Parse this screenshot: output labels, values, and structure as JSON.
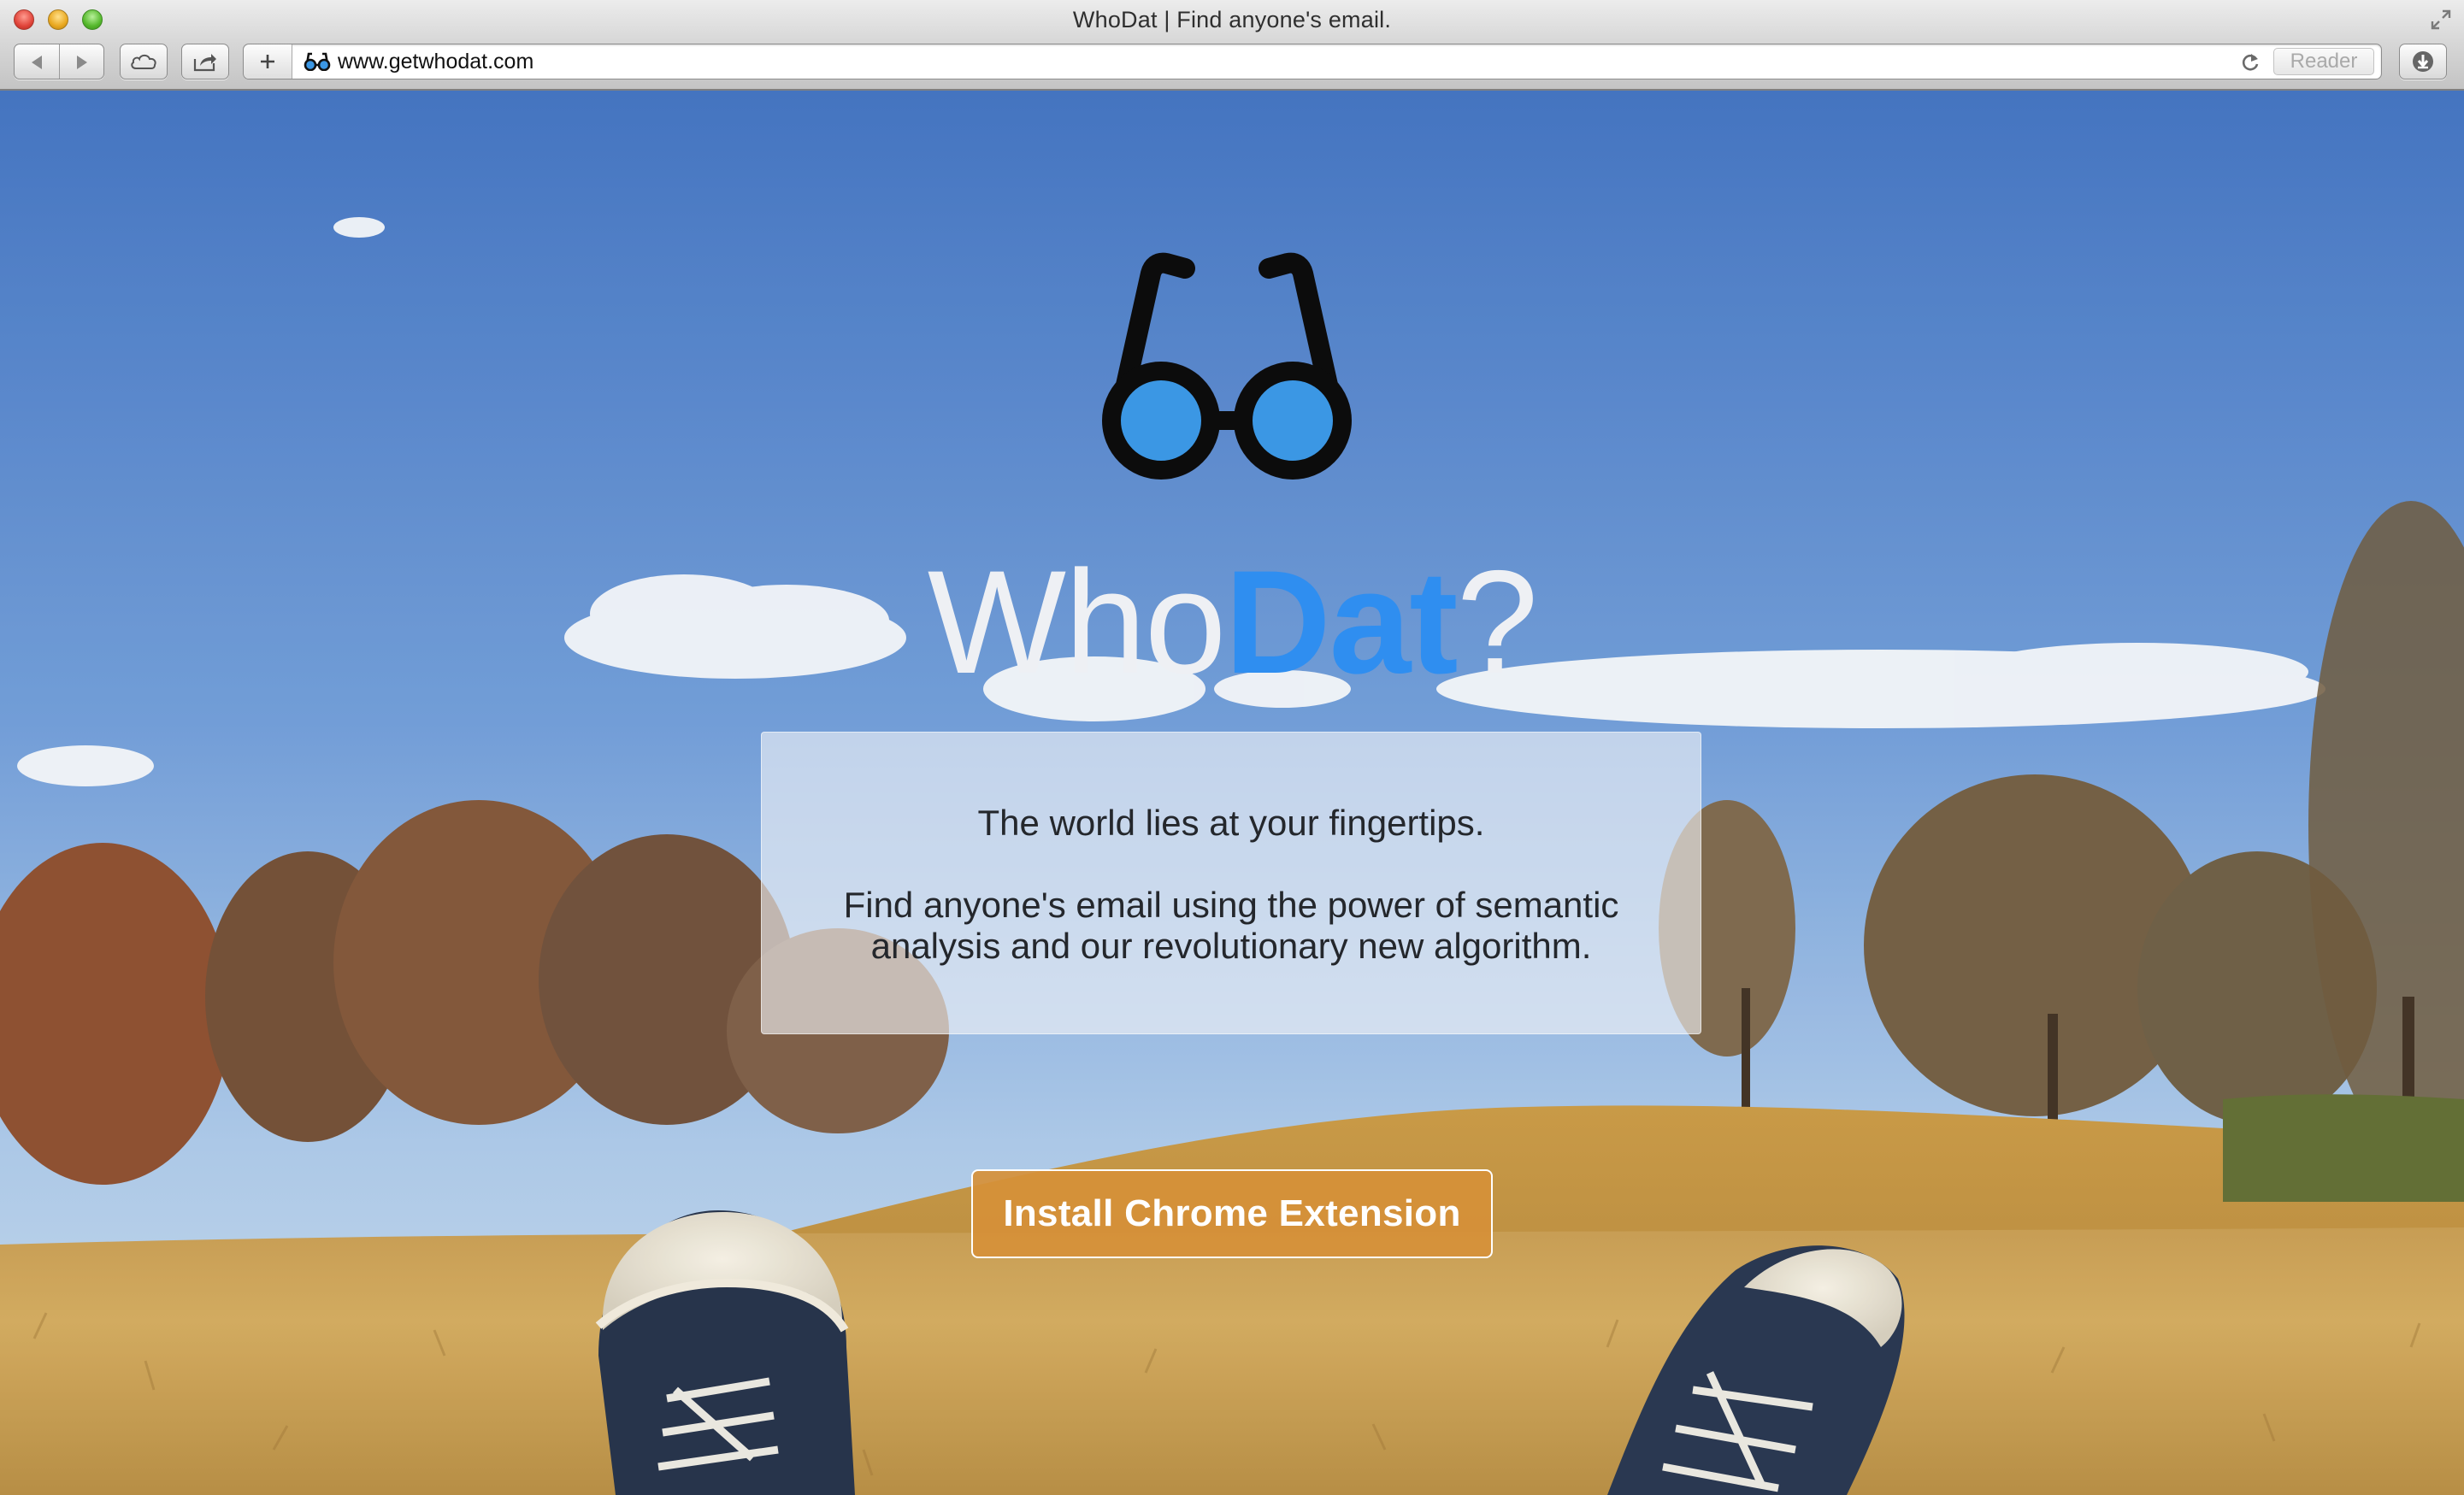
{
  "window": {
    "title": "WhoDat | Find anyone's email."
  },
  "toolbar": {
    "url": "www.getwhodat.com",
    "reader_label": "Reader",
    "icons": [
      "back-icon",
      "forward-icon",
      "icloud-tabs-icon",
      "share-icon",
      "add-tab-icon",
      "favicon-glasses-icon",
      "reload-icon",
      "downloads-icon",
      "fullscreen-icon"
    ]
  },
  "hero": {
    "logo_icon": "glasses-icon",
    "brand_who": "Who",
    "brand_dat": "Dat",
    "brand_q": "?",
    "tagline": "The world lies at your fingertips.",
    "description_line1": "Find anyone's email using the power of semantic",
    "description_line2": "analysis and our revolutionary new algorithm.",
    "cta_label": "Install Chrome Extension"
  },
  "colors": {
    "brand_accent": "#2f8ef0",
    "lens": "#3b97e4",
    "cta_background": "#d69038"
  }
}
